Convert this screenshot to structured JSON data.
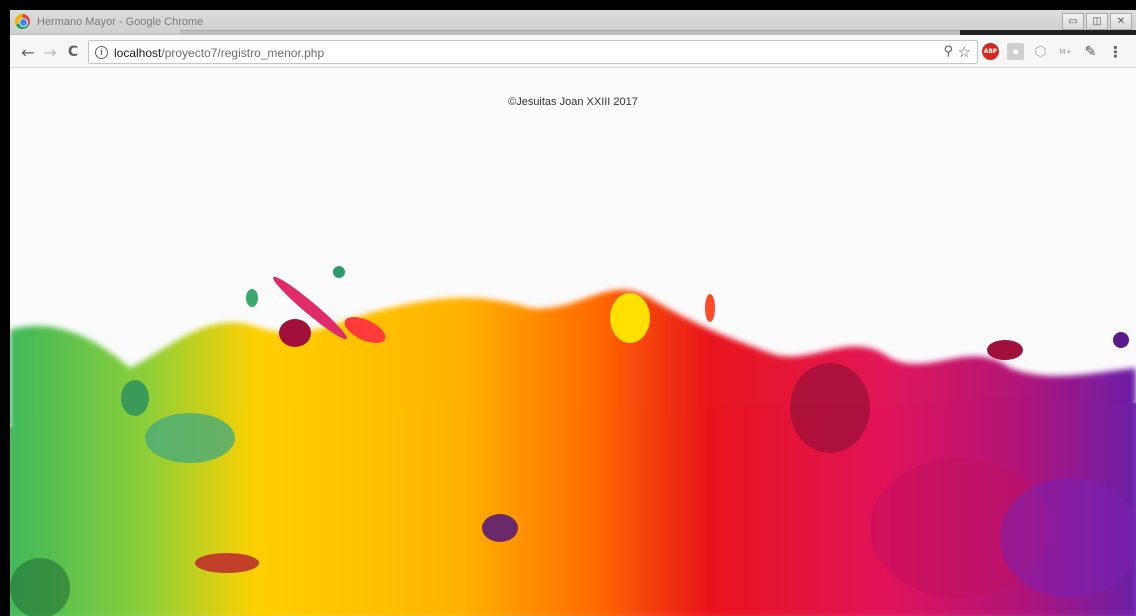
{
  "window": {
    "title": "Hermano Mayor - Google Chrome"
  },
  "window_controls": {
    "minimize": "▭",
    "restore": "◫",
    "close": "✕"
  },
  "toolbar": {
    "back": "←",
    "forward": "→",
    "reload": "C",
    "url_host": "localhost",
    "url_path": "/proyecto7/registro_menor.php",
    "info_icon": "i",
    "zoom_icon": "⚲",
    "star_icon": "☆"
  },
  "extensions": {
    "abp": "ABP",
    "pdf": "▪",
    "shield": "⬡",
    "small": "M+",
    "picker": "✎",
    "menu": "⋮"
  },
  "page": {
    "footer": "©Jesuitas Joan XXIII 2017"
  },
  "colors": {
    "green": "#4caf50",
    "yellow": "#ffd400",
    "orange": "#ff8c00",
    "red": "#e8131b",
    "magenta": "#d4145a",
    "purple": "#7b1fa2"
  }
}
